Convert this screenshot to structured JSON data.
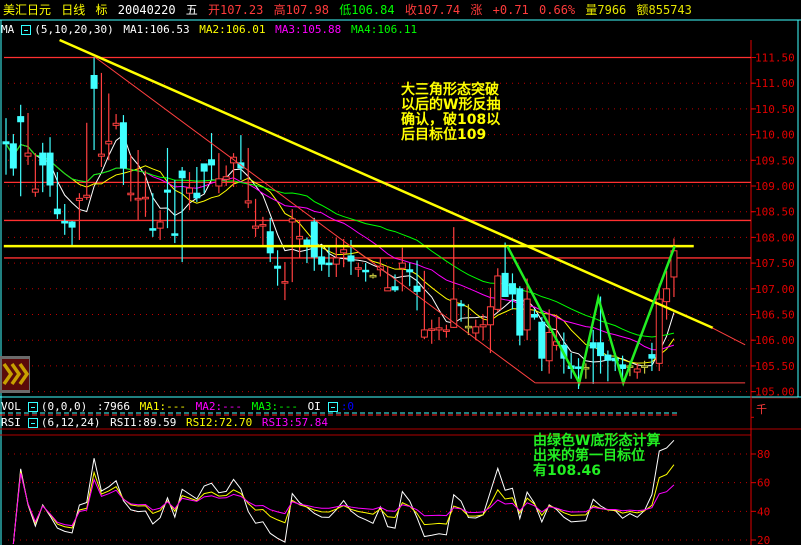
{
  "header": {
    "symbol": "美汇日元",
    "period": "日线",
    "mark": "标",
    "date": "20040220",
    "weekday": "五",
    "open": "开107.23",
    "high": "高107.98",
    "low": "低106.84",
    "close": "收107.74",
    "change_label": "涨",
    "change": "+0.71",
    "change_pct": "0.66%",
    "volume": "量7966",
    "amount": "额855743"
  },
  "ma_legend": {
    "name": "MA",
    "params": "(5,10,20,30)",
    "ma1": "MA1:106.53",
    "ma2": "MA2:106.01",
    "ma3": "MA3:105.88",
    "ma4": "MA4:106.11"
  },
  "vol_legend": {
    "name": "VOL",
    "params": "(0,0,0)",
    "value": ":7966",
    "ma1": "MA1:---",
    "ma2": "MA2:---",
    "ma3": "MA3:---",
    "oi": "OI",
    "oi_value": ":0"
  },
  "rsi_legend": {
    "name": "RSI",
    "params": "(6,12,24)",
    "rsi1": "RSI1:89.59",
    "rsi2": "RSI2:72.70",
    "rsi3": "RSI3:57.84"
  },
  "annotations": {
    "triangle": "大三角形态突破\n以后的W形反抽\n确认，破108以\n后目标位109",
    "w_bottom": "由绿色W底形态计算\n出来的第一目标位\n有108.46"
  },
  "axis_unit": "千",
  "colors": {
    "up": "#ff4040",
    "down": "#40ffff",
    "ma1": "#ffffff",
    "ma2": "#ffff00",
    "ma3": "#ff00ff",
    "ma4": "#00ff00",
    "frame": "#40ffff",
    "axis": "#e00000"
  },
  "chart_data": {
    "type": "candlestick",
    "title": "美汇日元 日线",
    "ylim": [
      104.7,
      111.85
    ],
    "yticks": [
      105.0,
      105.5,
      106.0,
      106.5,
      107.0,
      107.5,
      108.0,
      108.5,
      109.0,
      109.5,
      110.0,
      110.5,
      111.0,
      111.5
    ],
    "ohlc": [
      [
        109.86,
        110.32,
        109.22,
        109.82
      ],
      [
        109.82,
        110.01,
        109.2,
        109.35
      ],
      [
        110.35,
        110.58,
        108.8,
        110.25
      ],
      [
        109.58,
        110.42,
        109.41,
        109.64
      ],
      [
        108.88,
        109.64,
        108.79,
        108.94
      ],
      [
        109.64,
        109.84,
        108.88,
        109.41
      ],
      [
        109.64,
        109.95,
        108.79,
        109.02
      ],
      [
        108.55,
        109.27,
        108.36,
        108.46
      ],
      [
        108.31,
        108.65,
        108.05,
        108.28
      ],
      [
        108.3,
        108.32,
        107.85,
        108.2
      ],
      [
        108.72,
        108.86,
        107.95,
        108.76
      ],
      [
        108.78,
        110.23,
        108.73,
        108.82
      ],
      [
        111.15,
        111.5,
        109.7,
        110.9
      ],
      [
        109.58,
        111.2,
        109.37,
        109.62
      ],
      [
        109.82,
        110.8,
        109.5,
        109.87
      ],
      [
        110.18,
        110.4,
        110.1,
        110.22
      ],
      [
        110.23,
        110.38,
        109.02,
        109.35
      ],
      [
        108.83,
        109.6,
        108.7,
        108.86
      ],
      [
        108.73,
        109.7,
        108.34,
        108.76
      ],
      [
        108.75,
        109.3,
        108.4,
        108.78
      ],
      [
        108.17,
        108.86,
        108.01,
        108.14
      ],
      [
        108.18,
        108.53,
        107.95,
        108.3
      ],
      [
        108.92,
        109.74,
        108.18,
        108.88
      ],
      [
        108.07,
        109.12,
        107.89,
        108.04
      ],
      [
        109.29,
        109.37,
        107.52,
        109.16
      ],
      [
        108.86,
        109.27,
        108.53,
        108.96
      ],
      [
        108.86,
        109.37,
        108.69,
        108.77
      ],
      [
        109.43,
        109.43,
        108.86,
        109.29
      ],
      [
        109.51,
        110.03,
        109.12,
        109.41
      ],
      [
        109.0,
        109.64,
        108.86,
        109.14
      ],
      [
        109.13,
        109.4,
        109.0,
        109.18
      ],
      [
        109.45,
        109.64,
        108.98,
        109.56
      ],
      [
        109.45,
        109.99,
        109.12,
        109.35
      ],
      [
        108.67,
        109.74,
        108.57,
        108.71
      ],
      [
        108.18,
        108.75,
        108.01,
        108.22
      ],
      [
        108.22,
        108.4,
        107.85,
        108.25
      ],
      [
        108.11,
        108.38,
        107.52,
        107.7
      ],
      [
        107.44,
        107.75,
        107.06,
        107.4
      ],
      [
        107.11,
        107.52,
        106.78,
        107.14
      ],
      [
        108.3,
        108.55,
        107.13,
        108.36
      ],
      [
        107.97,
        108.34,
        107.6,
        108.02
      ],
      [
        107.95,
        108.0,
        107.5,
        107.85
      ],
      [
        108.3,
        108.38,
        107.35,
        107.62
      ],
      [
        107.62,
        107.83,
        107.35,
        107.48
      ],
      [
        107.5,
        107.85,
        107.23,
        107.47
      ],
      [
        107.48,
        108.0,
        107.23,
        107.6
      ],
      [
        107.7,
        107.97,
        107.42,
        107.76
      ],
      [
        107.64,
        107.95,
        107.27,
        107.54
      ],
      [
        107.39,
        107.51,
        107.23,
        107.41
      ],
      [
        107.36,
        107.5,
        107.14,
        107.34
      ],
      [
        107.26,
        107.3,
        107.2,
        107.26
      ],
      [
        107.37,
        107.61,
        107.24,
        107.44
      ],
      [
        106.96,
        107.44,
        106.96,
        107.02
      ],
      [
        107.04,
        107.28,
        106.94,
        106.98
      ],
      [
        107.4,
        107.8,
        106.95,
        107.5
      ],
      [
        107.37,
        107.5,
        107.05,
        107.33
      ],
      [
        107.05,
        107.55,
        106.58,
        106.95
      ],
      [
        106.06,
        107.35,
        106.02,
        106.2
      ],
      [
        106.2,
        106.4,
        105.93,
        106.22
      ],
      [
        106.2,
        106.45,
        106.0,
        106.24
      ],
      [
        106.18,
        106.3,
        106.05,
        106.2
      ],
      [
        106.25,
        108.2,
        106.24,
        106.8
      ],
      [
        106.7,
        106.78,
        106.36,
        106.67
      ],
      [
        106.27,
        106.7,
        106.1,
        106.27
      ],
      [
        106.14,
        106.4,
        106.0,
        106.26
      ],
      [
        106.26,
        106.5,
        106.0,
        106.3
      ],
      [
        106.3,
        107.02,
        105.75,
        106.65
      ],
      [
        106.6,
        107.4,
        106.55,
        107.25
      ],
      [
        107.3,
        107.9,
        106.84,
        106.85
      ],
      [
        107.1,
        107.3,
        106.6,
        106.9
      ],
      [
        107.0,
        107.05,
        105.9,
        106.1
      ],
      [
        106.2,
        107.2,
        106.0,
        106.8
      ],
      [
        106.5,
        106.6,
        106.4,
        106.45
      ],
      [
        106.35,
        106.45,
        105.4,
        105.65
      ],
      [
        105.6,
        106.6,
        105.35,
        106.15
      ],
      [
        105.9,
        106.5,
        105.8,
        105.97
      ],
      [
        105.9,
        106.15,
        105.35,
        105.65
      ],
      [
        105.5,
        105.75,
        105.25,
        105.45
      ],
      [
        105.48,
        105.65,
        105.05,
        105.46
      ],
      [
        105.47,
        105.55,
        105.25,
        105.47
      ],
      [
        105.95,
        106.2,
        105.15,
        105.85
      ],
      [
        105.95,
        106.85,
        105.35,
        105.7
      ],
      [
        105.71,
        105.8,
        105.2,
        105.61
      ],
      [
        105.65,
        105.75,
        105.4,
        105.6
      ],
      [
        105.52,
        105.7,
        105.2,
        105.45
      ],
      [
        105.5,
        105.6,
        105.3,
        105.5
      ],
      [
        105.38,
        105.55,
        105.25,
        105.44
      ],
      [
        105.5,
        105.6,
        105.35,
        105.5
      ],
      [
        105.72,
        105.95,
        105.4,
        105.65
      ],
      [
        105.55,
        107.1,
        105.4,
        106.8
      ],
      [
        106.75,
        107.35,
        106.4,
        107.0
      ],
      [
        107.23,
        107.98,
        106.84,
        107.74
      ]
    ],
    "ma_periods": [
      5,
      10,
      20,
      30
    ],
    "support_resistance_levels": [
      111.5,
      109.07,
      108.33,
      107.6
    ],
    "trendlines": [
      {
        "name": "triangle-upper",
        "color": "#ffff00",
        "points": [
          [
            7.3,
            111.84
          ],
          [
            96.3,
            106.24
          ]
        ]
      },
      {
        "name": "neckline",
        "color": "#ffff00",
        "points": [
          [
            -0.3,
            107.83
          ],
          [
            93.7,
            107.83
          ]
        ]
      },
      {
        "name": "w-bottom",
        "color": "#22ee22",
        "points": [
          [
            68.3,
            107.83
          ],
          [
            78.1,
            105.17
          ],
          [
            80.7,
            106.82
          ],
          [
            84.1,
            105.17
          ],
          [
            91.1,
            107.83
          ]
        ]
      },
      {
        "name": "triangle-lower",
        "color": "#ff4040",
        "points": [
          [
            12.1,
            111.51
          ],
          [
            72.1,
            105.17
          ]
        ]
      },
      {
        "name": "triangle-extension",
        "color": "#ff4040",
        "points": [
          [
            96.2,
            106.24
          ],
          [
            100.7,
            105.91
          ]
        ]
      },
      {
        "name": "base-line",
        "color": "#ff4040",
        "points": [
          [
            72.1,
            105.17
          ],
          [
            100.7,
            105.17
          ]
        ]
      }
    ],
    "rsi": {
      "periods": [
        6,
        12,
        24
      ],
      "ylim": [
        20,
        93
      ],
      "yticks": [
        20,
        40,
        60,
        80
      ]
    }
  }
}
